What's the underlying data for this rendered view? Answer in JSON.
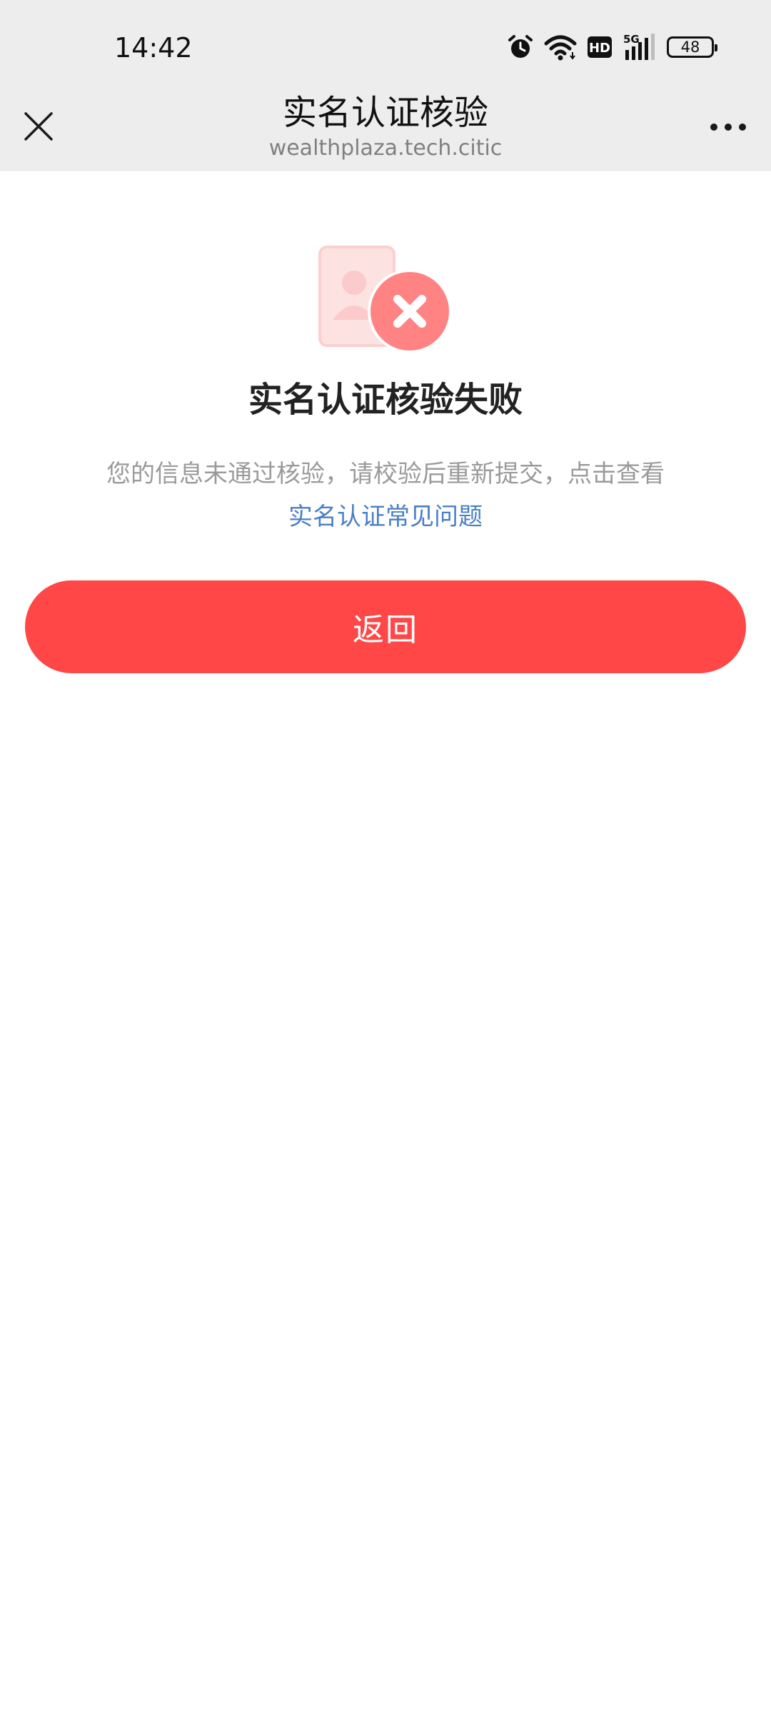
{
  "status_bar": {
    "time": "14:42",
    "network": "5G",
    "hd_badge": "HD",
    "battery": "48",
    "icons": [
      "alarm-icon",
      "wifi-icon",
      "hd-icon",
      "signal-icon",
      "battery-icon"
    ]
  },
  "header": {
    "title": "实名认证核验",
    "subtitle": "wealthplaza.tech.citic",
    "close_icon": "close-icon",
    "more_icon": "more-icon"
  },
  "result": {
    "illustration_icon": "id-card-error-icon",
    "title": "实名认证核验失败",
    "description": "您的信息未通过核验，请校验后重新提交，点击查看",
    "faq_link": "实名认证常见问题"
  },
  "actions": {
    "back_label": "返回"
  },
  "colors": {
    "header_bg": "#ededed",
    "accent": "#ff4747",
    "link": "#4a7fc7",
    "error_icon": "#ff8080",
    "muted_text": "#9a9a9a"
  }
}
